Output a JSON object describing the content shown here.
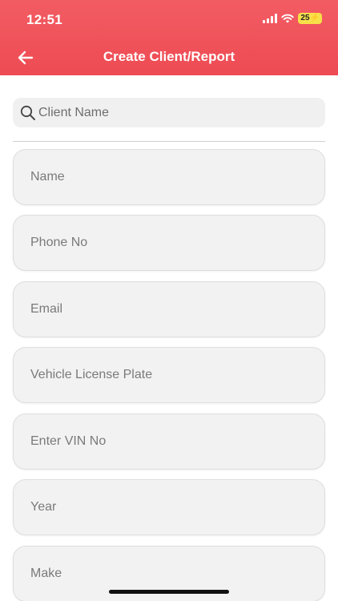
{
  "status_bar": {
    "time": "12:51",
    "battery": "25"
  },
  "header": {
    "title": "Create Client/Report",
    "back_icon": "arrow-left-icon"
  },
  "search": {
    "placeholder": "Client Name",
    "icon": "search-icon"
  },
  "fields": [
    {
      "placeholder": "Name"
    },
    {
      "placeholder": "Phone No"
    },
    {
      "placeholder": "Email"
    },
    {
      "placeholder": "Vehicle License Plate"
    },
    {
      "placeholder": "Enter VIN No"
    },
    {
      "placeholder": "Year"
    },
    {
      "placeholder": "Make"
    }
  ],
  "colors": {
    "header": "#ef5058",
    "field_bg": "#f2f2f2",
    "battery": "#f7e04a"
  }
}
